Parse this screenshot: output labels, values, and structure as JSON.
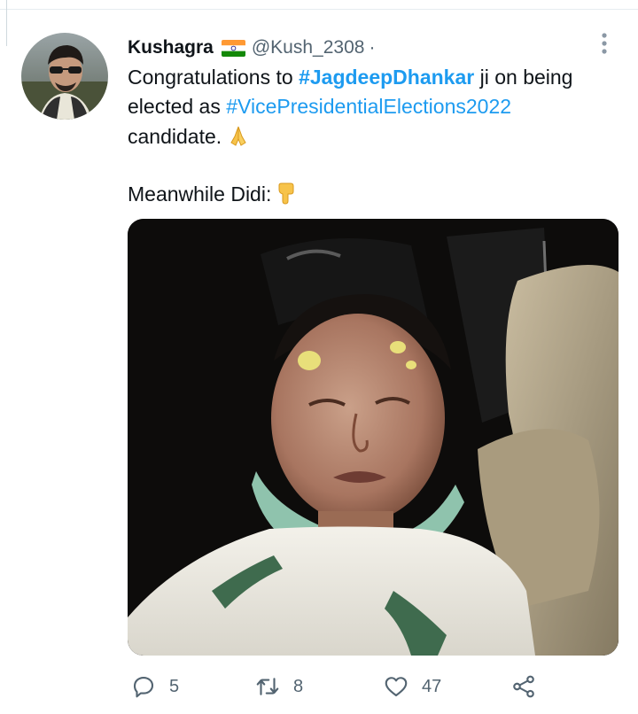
{
  "tweet": {
    "display_name": "Kushagra",
    "handle": "@Kush_2308",
    "separator": "·",
    "line1_prefix": "Congratulations to ",
    "hashtag1": "#JagdeepDhankar",
    "line1_suffix": " ji on being",
    "line2_prefix": "elected as ",
    "hashtag2": "#VicePresidentialElections2022",
    "line3": "candidate.",
    "line5": "Meanwhile Didi:",
    "emoji_1": "folded-hands-emoji",
    "emoji_2": "pointing-down-emoji"
  },
  "actions": {
    "replies": "5",
    "retweets": "8",
    "likes": "47"
  },
  "icons": {
    "reply": "reply-icon",
    "retweet": "retweet-icon",
    "like": "heart-icon",
    "share": "share-icon",
    "more": "more-vertical-icon",
    "flag": "india-flag-icon"
  },
  "colors": {
    "link": "#1d9bf0",
    "secondary_text": "#536471",
    "primary_text": "#0f1419"
  }
}
